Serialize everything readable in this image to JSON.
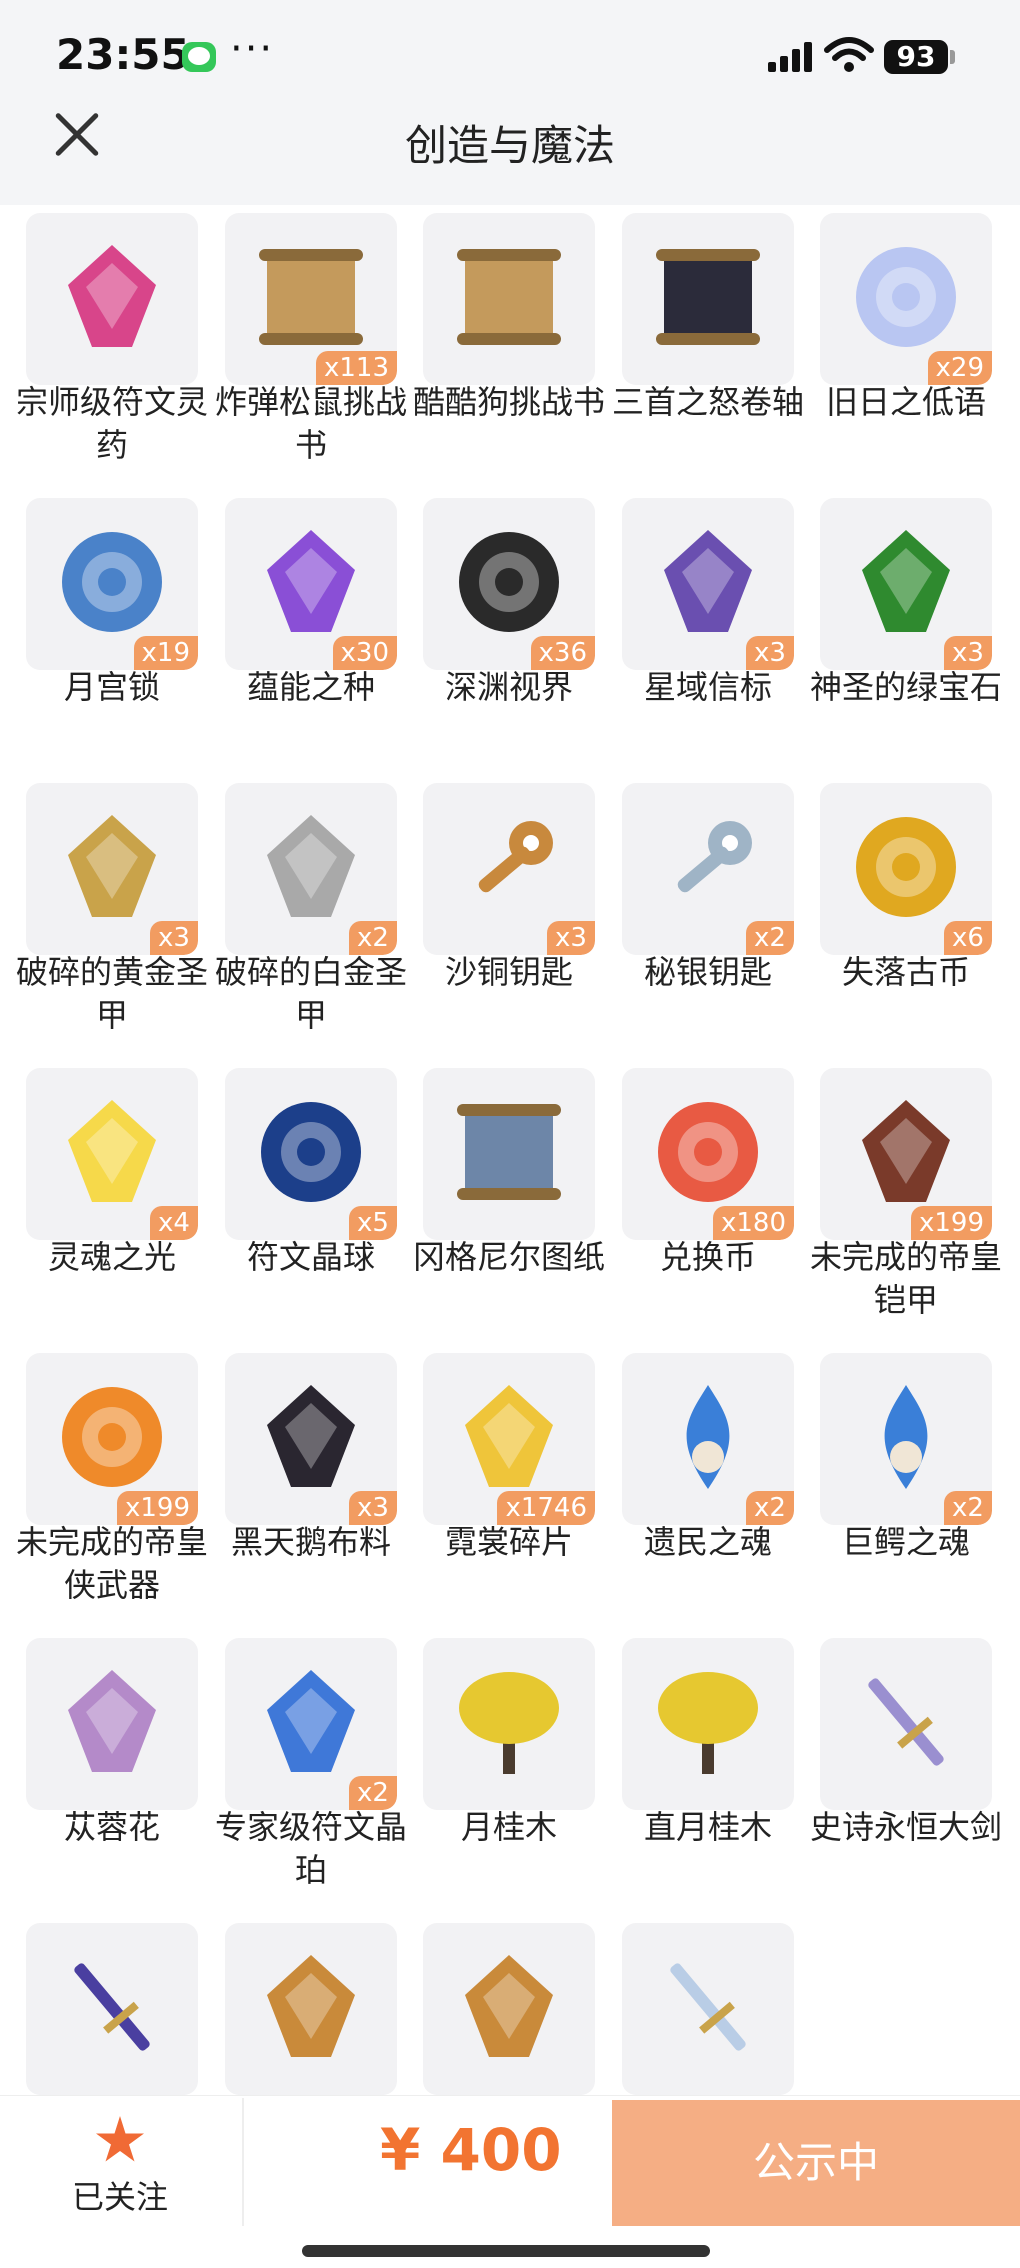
{
  "status_bar": {
    "time": "23:55",
    "battery": "93",
    "more": "···"
  },
  "header": {
    "title": "创造与魔法",
    "close_icon": "close-icon"
  },
  "items": [
    {
      "name": "宗师级符文灵药",
      "qty": "",
      "icon": "heart-potion-icon",
      "color": "#d8458a"
    },
    {
      "name": "炸弹松鼠挑战书",
      "qty": "x113",
      "icon": "wanted-scroll-icon",
      "color": "#c49a5c"
    },
    {
      "name": "酷酷狗挑战书",
      "qty": "",
      "icon": "wanted-scroll-icon",
      "color": "#c49a5c"
    },
    {
      "name": "三首之怒卷轴",
      "qty": "",
      "icon": "dark-scroll-icon",
      "color": "#2b2b3a"
    },
    {
      "name": "旧日之低语",
      "qty": "x29",
      "icon": "glowing-orb-icon",
      "color": "#b9c6f2"
    },
    {
      "name": "月宫锁",
      "qty": "x19",
      "icon": "blue-lock-icon",
      "color": "#4a82c9"
    },
    {
      "name": "蕴能之种",
      "qty": "x30",
      "icon": "purple-crystal-icon",
      "color": "#8a4fd6"
    },
    {
      "name": "深渊视界",
      "qty": "x36",
      "icon": "abyss-sun-icon",
      "color": "#2a2a2a"
    },
    {
      "name": "星域信标",
      "qty": "x3",
      "icon": "eye-beacon-icon",
      "color": "#6a4fb0"
    },
    {
      "name": "神圣的绿宝石",
      "qty": "x3",
      "icon": "emerald-icon",
      "color": "#2f8a2f"
    },
    {
      "name": "破碎的黄金圣甲",
      "qty": "x3",
      "icon": "broken-gold-armor-icon",
      "color": "#c9a34a"
    },
    {
      "name": "破碎的白金圣甲",
      "qty": "x2",
      "icon": "broken-platinum-armor-icon",
      "color": "#a9a9a9"
    },
    {
      "name": "沙铜钥匙",
      "qty": "x3",
      "icon": "bronze-key-icon",
      "color": "#c8893d"
    },
    {
      "name": "秘银钥匙",
      "qty": "x2",
      "icon": "mithril-key-icon",
      "color": "#9fb4c6"
    },
    {
      "name": "失落古币",
      "qty": "x6",
      "icon": "gold-coin-icon",
      "color": "#e0a820"
    },
    {
      "name": "灵魂之光",
      "qty": "x4",
      "icon": "soul-light-icon",
      "color": "#f6d94a"
    },
    {
      "name": "符文晶球",
      "qty": "x5",
      "icon": "rune-orb-icon",
      "color": "#1c3f8a"
    },
    {
      "name": "冈格尼尔图纸",
      "qty": "",
      "icon": "blueprint-icon",
      "color": "#6d86a8"
    },
    {
      "name": "兑换币",
      "qty": "x180",
      "icon": "exchange-coin-icon",
      "color": "#e85a43"
    },
    {
      "name": "未完成的帝皇铠甲",
      "qty": "x199",
      "icon": "armor-stand-icon",
      "color": "#7a3a2a"
    },
    {
      "name": "未完成的帝皇侠武器",
      "qty": "x199",
      "icon": "fire-gear-icon",
      "color": "#ef8a2a"
    },
    {
      "name": "黑天鹅布料",
      "qty": "x3",
      "icon": "black-cloth-icon",
      "color": "#2a2630"
    },
    {
      "name": "霓裳碎片",
      "qty": "x1746",
      "icon": "shirt-icon",
      "color": "#efc53a"
    },
    {
      "name": "遗民之魂",
      "qty": "x2",
      "icon": "blue-flame-soul-icon",
      "color": "#3a7fd8"
    },
    {
      "name": "巨鳄之魂",
      "qty": "x2",
      "icon": "blue-flame-soul-icon",
      "color": "#3a7fd8"
    },
    {
      "name": "苁蓉花",
      "qty": "",
      "icon": "cistanche-icon",
      "color": "#b48ac9"
    },
    {
      "name": "专家级符文晶珀",
      "qty": "x2",
      "icon": "rune-amber-icon",
      "color": "#3f78d8"
    },
    {
      "name": "月桂木",
      "qty": "",
      "icon": "golden-tree-icon",
      "color": "#e6c830"
    },
    {
      "name": "直月桂木",
      "qty": "",
      "icon": "golden-tree-icon",
      "color": "#e6c830"
    },
    {
      "name": "史诗永恒大剑",
      "qty": "",
      "icon": "greatsword-icon",
      "color": "#9a8fd0"
    },
    {
      "name": "",
      "qty": "",
      "icon": "axe-icon",
      "color": "#4a3fa0"
    },
    {
      "name": "",
      "qty": "",
      "icon": "gold-emblem-icon",
      "color": "#c98a3a"
    },
    {
      "name": "",
      "qty": "",
      "icon": "gold-emblem-icon",
      "color": "#c98a3a"
    },
    {
      "name": "",
      "qty": "",
      "icon": "crystal-blade-icon",
      "color": "#b9cde6"
    }
  ],
  "bottom_bar": {
    "follow_label": "已关注",
    "price": "¥ 400",
    "status_button": "公示中",
    "accent": "#f27431"
  }
}
